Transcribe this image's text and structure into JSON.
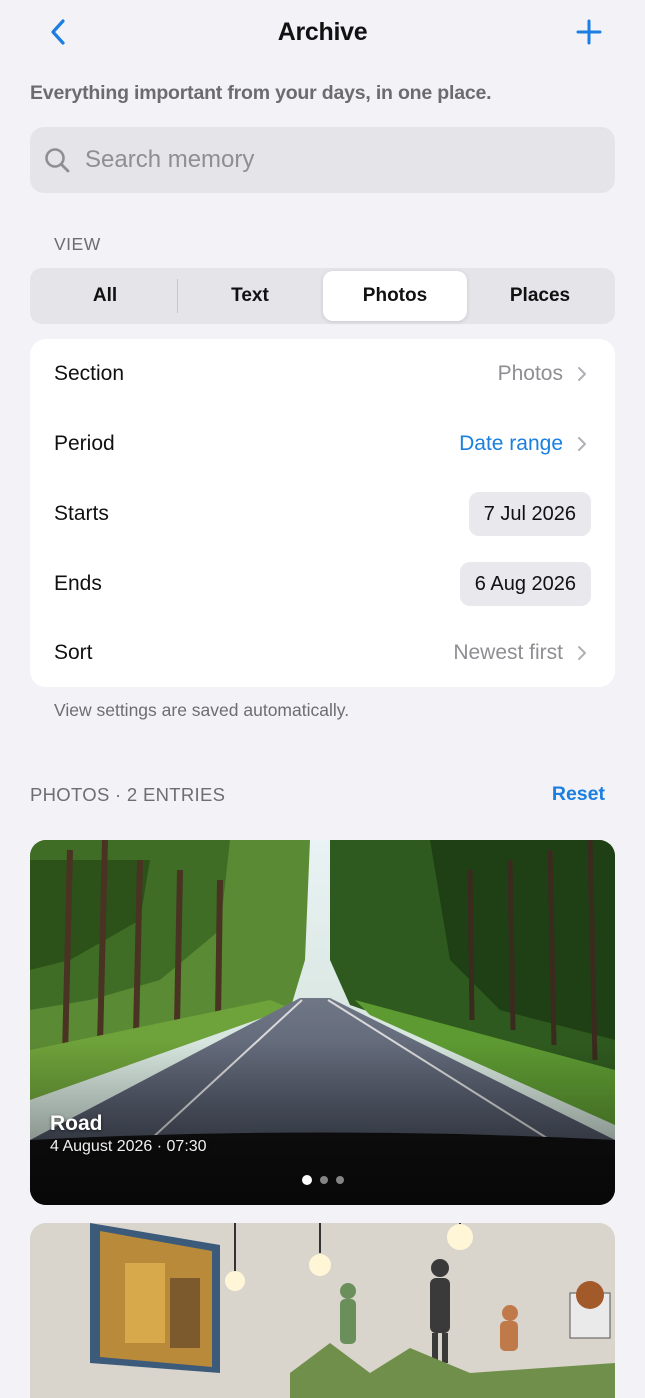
{
  "header": {
    "title": "Archive",
    "back_icon": "chevron-left-icon",
    "add_icon": "plus-icon"
  },
  "subtitle": "Everything important from your days, in one place.",
  "search": {
    "placeholder": "Search memory",
    "value": ""
  },
  "view": {
    "label": "VIEW",
    "segments": [
      "All",
      "Text",
      "Photos",
      "Places"
    ],
    "selected": "Photos"
  },
  "settings": {
    "section": {
      "label": "Section",
      "value": "Photos"
    },
    "period": {
      "label": "Period",
      "value": "Date range"
    },
    "starts": {
      "label": "Starts",
      "value": "7 Jul 2026"
    },
    "ends": {
      "label": "Ends",
      "value": "6 Aug 2026"
    },
    "sort": {
      "label": "Sort",
      "value": "Newest first"
    }
  },
  "footnote": "View settings are saved automatically.",
  "list": {
    "header": "PHOTOS · 2 ENTRIES",
    "reset_label": "Reset",
    "entries": [
      {
        "title": "Road",
        "timestamp": "4 August 2026 · 07:30",
        "pages": 3,
        "current_page": 1
      }
    ]
  },
  "colors": {
    "accent": "#1a7fe0",
    "background": "#f2f2f7",
    "card": "#ffffff",
    "secondary_text": "#8e8e93"
  }
}
